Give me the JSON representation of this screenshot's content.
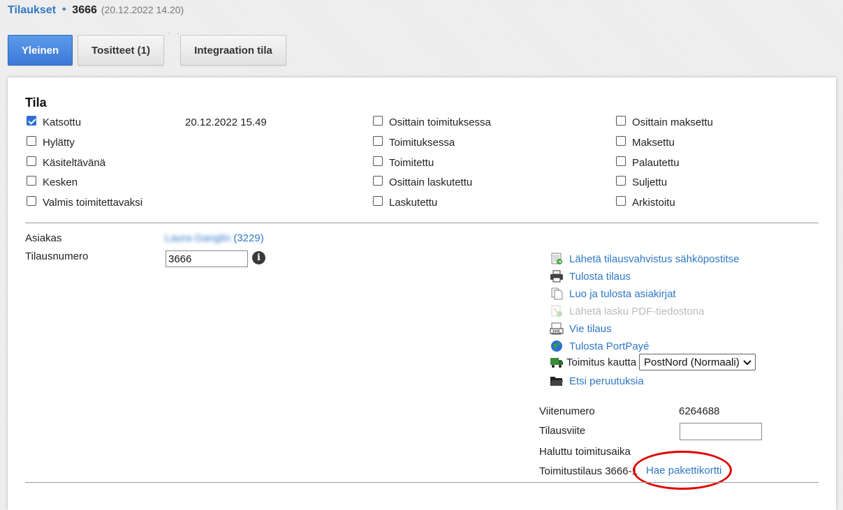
{
  "breadcrumb": {
    "root": "Tilaukset",
    "separator": "✦",
    "order_number": "3666",
    "order_date": "(20.12.2022 14.20)"
  },
  "tabs": [
    {
      "label": "Yleinen",
      "active": true
    },
    {
      "label": "Tositteet (1)",
      "active": false
    },
    {
      "label": "Integraation tila",
      "active": false
    }
  ],
  "tab_overflow": "· ·",
  "status": {
    "title": "Tila",
    "katsottu_time": "20.12.2022 15.49",
    "col1": [
      {
        "label": "Katsottu",
        "checked": true
      },
      {
        "label": "Hylätty",
        "checked": false
      },
      {
        "label": "Käsiteltävänä",
        "checked": false
      },
      {
        "label": "Kesken",
        "checked": false
      },
      {
        "label": "Valmis toimitettavaksi",
        "checked": false
      }
    ],
    "col2": [
      {
        "label": "Osittain toimituksessa",
        "checked": false
      },
      {
        "label": "Toimituksessa",
        "checked": false
      },
      {
        "label": "Toimitettu",
        "checked": false
      },
      {
        "label": "Osittain laskutettu",
        "checked": false
      },
      {
        "label": "Laskutettu",
        "checked": false
      }
    ],
    "col3": [
      {
        "label": "Osittain maksettu",
        "checked": false
      },
      {
        "label": "Maksettu",
        "checked": false
      },
      {
        "label": "Palautettu",
        "checked": false
      },
      {
        "label": "Suljettu",
        "checked": false
      },
      {
        "label": "Arkistoitu",
        "checked": false
      }
    ]
  },
  "details": {
    "asiakas_label": "Asiakas",
    "asiakas_name": "Laura Ganglin",
    "asiakas_id": "(3229)",
    "tilausnumero_label": "Tilausnumero",
    "tilausnumero_value": "3666",
    "info_glyph": "i"
  },
  "actions": {
    "send_confirmation": "Lähetä tilausvahvistus sähköpostitse",
    "print_order": "Tulosta tilaus",
    "create_documents": "Luo ja tulosta asiakirjat",
    "send_invoice_pdf": "Lähetä lasku PDF-tiedostona",
    "export_order": "Vie tilaus",
    "print_portpaye": "Tulosta PortPayé",
    "shipping_label": "Toimitus kautta",
    "shipping_selected": "PostNord (Normaali)",
    "search_cancellations": "Etsi peruutuksia"
  },
  "reference": {
    "viitenumero_label": "Viitenumero",
    "viitenumero_value": "6264688",
    "tilausviite_label": "Tilausviite",
    "tilausviite_value": "",
    "haluttu_label": "Haluttu toimitusaika",
    "toimitustilaus_label": "Toimitustilaus 3666-1",
    "hae_link": "Hae pakettikortti"
  },
  "colors": {
    "accent": "#3b78d8",
    "link": "#2f78c4",
    "highlight": "#e00000"
  }
}
